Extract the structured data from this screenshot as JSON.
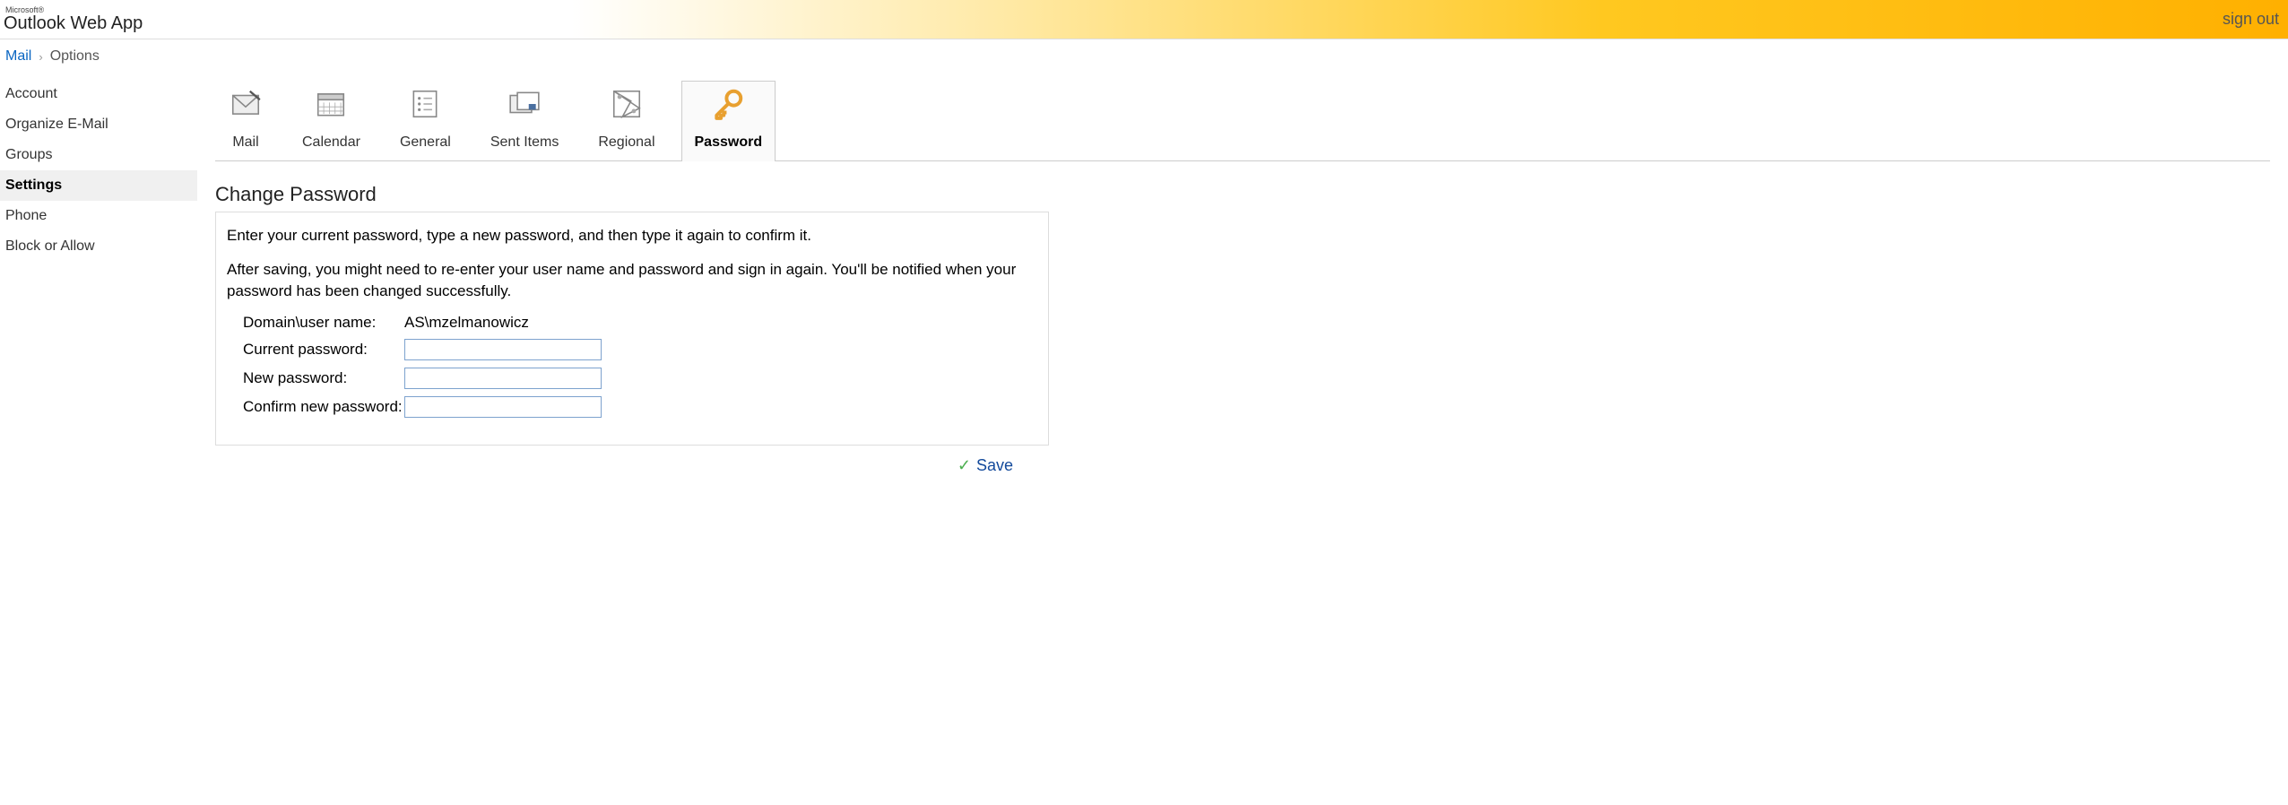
{
  "header": {
    "microsoft": "Microsoft®",
    "app_name_strong": "Outlook",
    "app_name_light": " Web App",
    "sign_out": "sign out"
  },
  "breadcrumb": {
    "root": "Mail",
    "current": "Options"
  },
  "sidebar": {
    "items": [
      {
        "label": "Account",
        "active": false
      },
      {
        "label": "Organize E-Mail",
        "active": false
      },
      {
        "label": "Groups",
        "active": false
      },
      {
        "label": "Settings",
        "active": true
      },
      {
        "label": "Phone",
        "active": false
      },
      {
        "label": "Block or Allow",
        "active": false
      }
    ]
  },
  "tabs": [
    {
      "label": "Mail",
      "icon": "mail-icon",
      "active": false
    },
    {
      "label": "Calendar",
      "icon": "calendar-icon",
      "active": false
    },
    {
      "label": "General",
      "icon": "general-icon",
      "active": false
    },
    {
      "label": "Sent Items",
      "icon": "sent-items-icon",
      "active": false
    },
    {
      "label": "Regional",
      "icon": "regional-icon",
      "active": false
    },
    {
      "label": "Password",
      "icon": "password-icon",
      "active": true
    }
  ],
  "panel": {
    "title": "Change Password",
    "intro1": "Enter your current password, type a new password, and then type it again to confirm it.",
    "intro2": "After saving, you might need to re-enter your user name and password and sign in again. You'll be notified when your password has been changed successfully.",
    "fields": {
      "domain_user_label": "Domain\\user name:",
      "domain_user_value": "AS\\mzelmanowicz",
      "current_pw_label": "Current password:",
      "current_pw_value": "",
      "new_pw_label": "New password:",
      "new_pw_value": "",
      "confirm_pw_label": "Confirm new password:",
      "confirm_pw_value": ""
    }
  },
  "actions": {
    "save": "Save"
  }
}
